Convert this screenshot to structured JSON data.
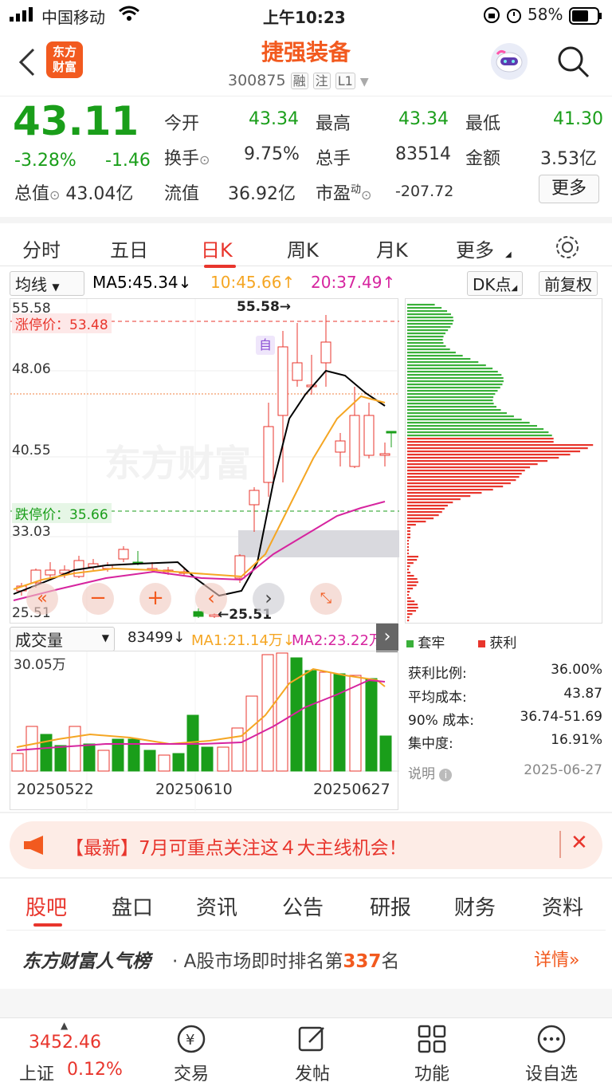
{
  "status_bar": {
    "carrier": "中国移动",
    "time": "上午10:23",
    "battery": "58%"
  },
  "header": {
    "title": "捷强装备",
    "code": "300875",
    "badge1": "融",
    "badge2": "注",
    "badge3": "L1",
    "logo_line1": "东方",
    "logo_line2": "财富"
  },
  "quote": {
    "price": "43.11",
    "change_pct": "-3.28%",
    "change": "-1.46",
    "open_label": "今开",
    "open": "43.34",
    "high_label": "最高",
    "high": "43.34",
    "low_label": "最低",
    "low": "41.30",
    "turnover_label": "换手",
    "turnover": "9.75%",
    "volume_label": "总手",
    "volume": "83514",
    "amount_label": "金额",
    "amount": "3.53亿",
    "mktcap_label": "总值",
    "mktcap": "43.04亿",
    "float_label": "流值",
    "float": "36.92亿",
    "pe_label": "市盈",
    "pe_sup": "动",
    "pe": "-207.72",
    "more": "更多"
  },
  "tabs": [
    "分时",
    "五日",
    "日K",
    "周K",
    "月K",
    "更多",
    ""
  ],
  "chart_toolbar": {
    "ma_select": "均线",
    "ma5": "MA5:45.34↓",
    "ma10": "10:45.66↑",
    "ma20": "20:37.49↑",
    "dk": "DK点",
    "fq": "前复权"
  },
  "kline": {
    "y_labels": [
      "55.58",
      "48.06",
      "40.55",
      "33.03",
      "25.51"
    ],
    "limit_up": "涨停价：53.48",
    "limit_down": "跌停价：35.66",
    "high_mark": "55.58→",
    "low_mark": "←25.51",
    "watermark": "东方财富",
    "marker_zi": "自"
  },
  "volume_toolbar": {
    "select": "成交量",
    "value": "83499↓",
    "ma1": "MA1:21.14万↓",
    "ma2": "MA2:23.22万↓"
  },
  "volume": {
    "max_label": "30.05万",
    "dates": [
      "20250522",
      "20250610",
      "20250627"
    ]
  },
  "chip_panel": {
    "legend_trapped": "套牢",
    "legend_profit": "获利",
    "rows": [
      {
        "label": "获利比例:",
        "value": "36.00%"
      },
      {
        "label": "平均成本:",
        "value": "43.87"
      },
      {
        "label": "90% 成本:",
        "value": "36.74-51.69"
      },
      {
        "label": "集中度:",
        "value": "16.91%"
      }
    ],
    "note": "说明",
    "date": "2025-06-27"
  },
  "notice": {
    "text": "【最新】7月可重点关注这４大主线机会！"
  },
  "bottom_tabs": [
    "股吧",
    "盘口",
    "资讯",
    "公告",
    "研报",
    "财务",
    "资料"
  ],
  "rank": {
    "title": "东方财富人气榜",
    "text": "· A股市场即时排名第",
    "num": "337",
    "suffix": "名",
    "detail": "详情"
  },
  "bottom_nav": {
    "index_value": "3452.46",
    "index_name": "上证",
    "index_pct": "0.12%",
    "trade": "交易",
    "post": "发帖",
    "func": "功能",
    "watch": "设自选"
  },
  "colors": {
    "up": "#e8352c",
    "down": "#1a9e1a",
    "ma5": "#000000",
    "ma10": "#f5a623",
    "ma20": "#d6249f",
    "accent": "#f25a1f"
  }
}
